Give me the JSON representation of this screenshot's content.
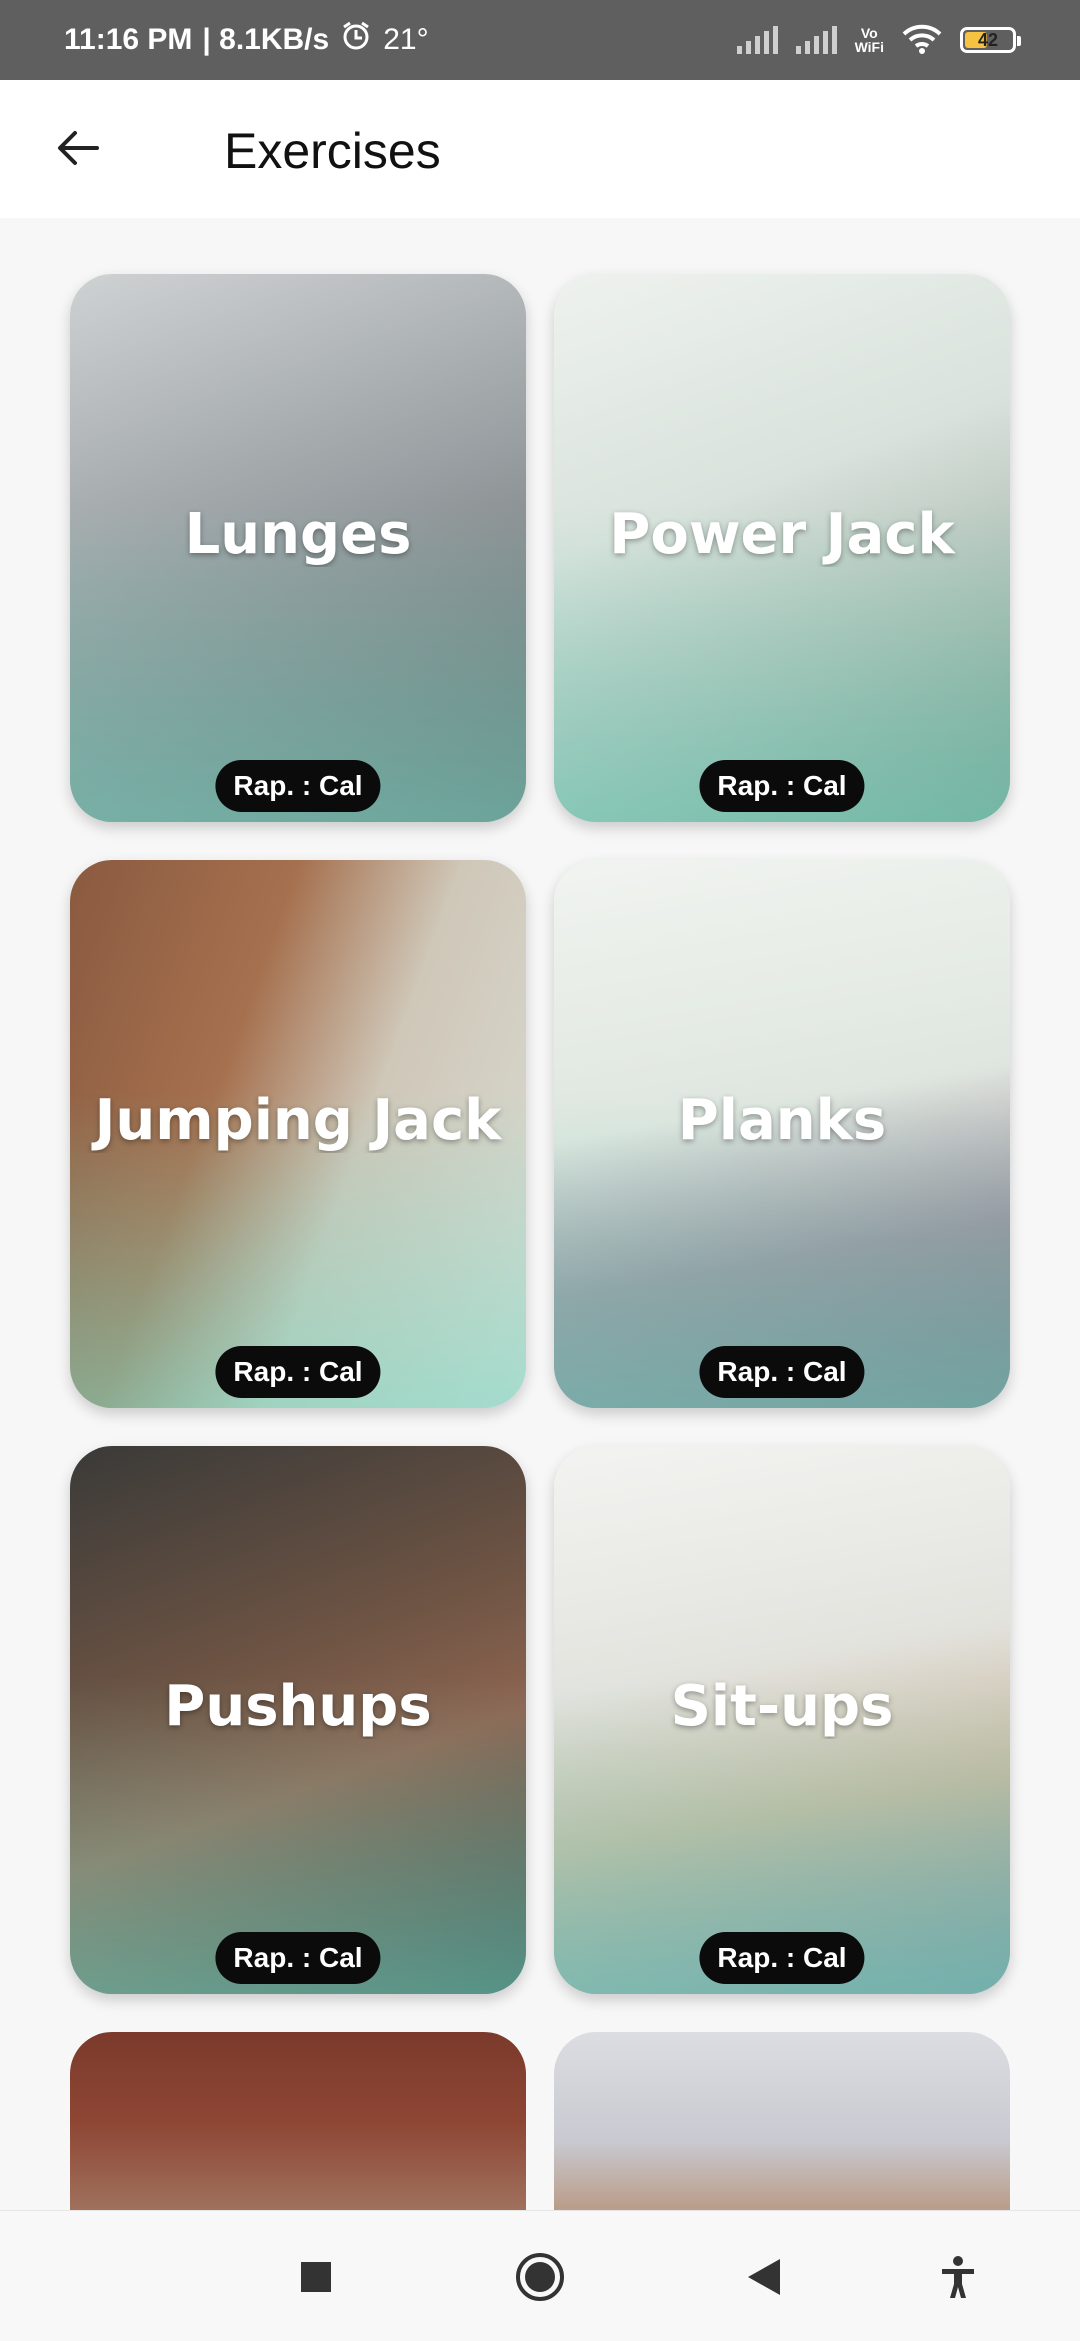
{
  "status_bar": {
    "time": "11:16 PM",
    "speed": "| 8.1KB/s",
    "temp": "21°",
    "network_label": "Vo\nWiFi",
    "battery": "42"
  },
  "app_bar": {
    "title": "Exercises"
  },
  "exercises": [
    {
      "name": "Lunges",
      "info": "Rap. : Cal"
    },
    {
      "name": "Power Jack",
      "info": "Rap. : Cal"
    },
    {
      "name": "Jumping Jack",
      "info": "Rap. : Cal"
    },
    {
      "name": "Planks",
      "info": "Rap. : Cal"
    },
    {
      "name": "Pushups",
      "info": "Rap. : Cal"
    },
    {
      "name": "Sit-ups",
      "info": "Rap. : Cal"
    }
  ],
  "colors": {
    "status_bar": "#5f5f5f",
    "pill": "#0b0b0b",
    "card_fade": "#78dcc8"
  },
  "icons": [
    "back-arrow-icon",
    "alarm-icon",
    "signal-icon",
    "wifi-icon",
    "battery-icon",
    "recents-square-icon",
    "home-circle-icon",
    "back-triangle-icon",
    "accessibility-icon"
  ]
}
